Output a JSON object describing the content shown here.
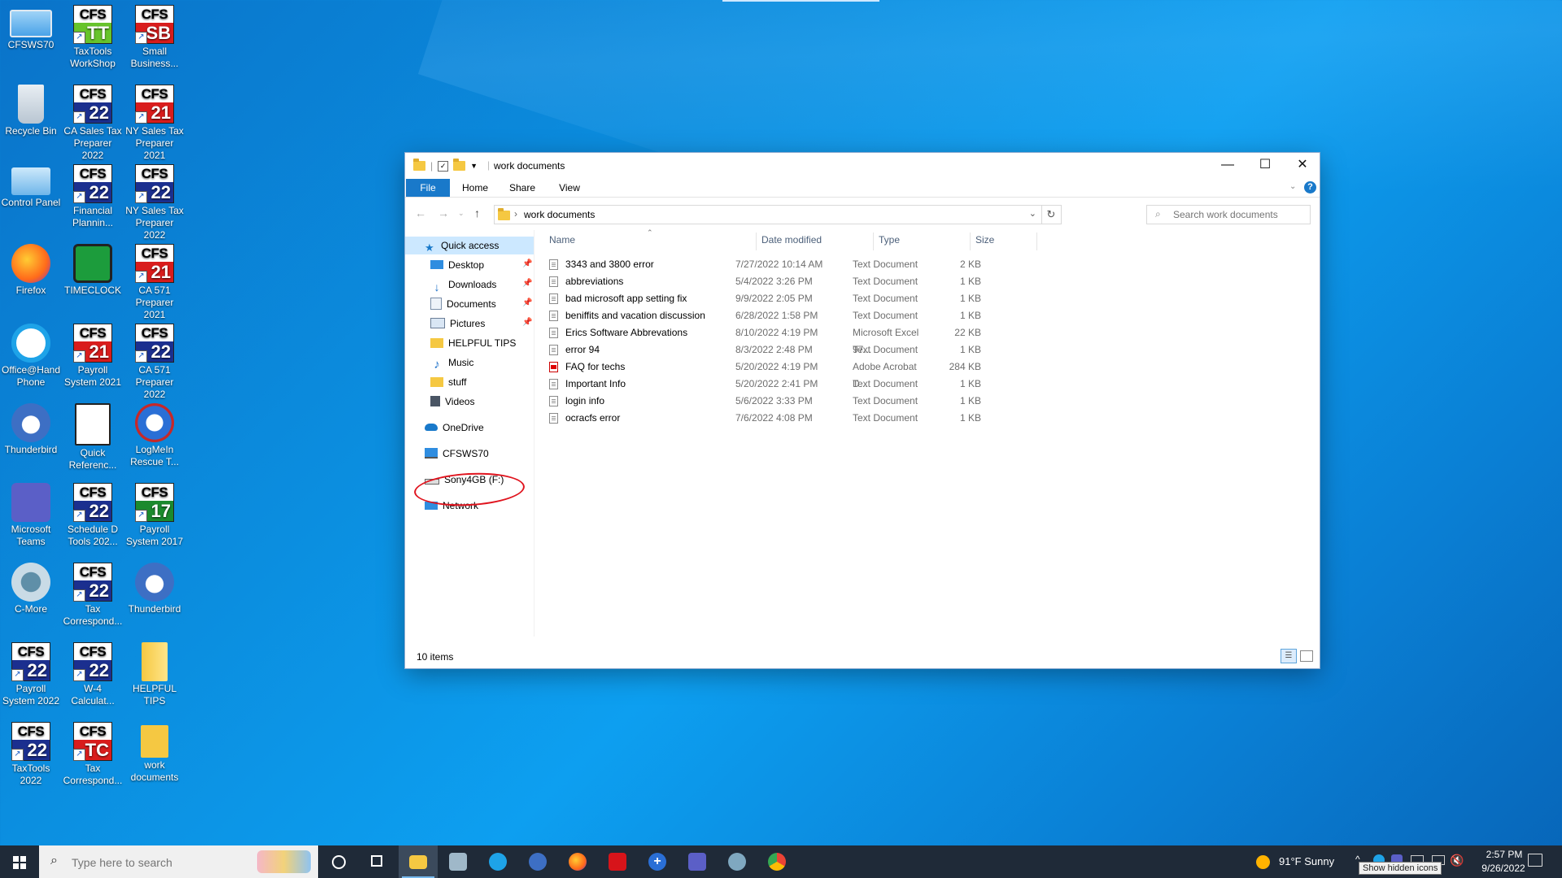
{
  "desktop": {
    "icons": [
      {
        "label": "CFSWS70"
      },
      {
        "label": "TaxTools WorkShop",
        "badge_top": "CFS",
        "badge_bottom": "TT"
      },
      {
        "label": "Small Business...",
        "badge_top": "CFS",
        "badge_bottom": "SB"
      },
      {
        "label": "Recycle Bin"
      },
      {
        "label": "CA Sales Tax Preparer 2022",
        "badge_top": "CFS",
        "badge_bottom": "22"
      },
      {
        "label": "NY Sales Tax Preparer 2021",
        "badge_top": "CFS",
        "badge_bottom": "21"
      },
      {
        "label": "Control Panel"
      },
      {
        "label": "Financial Plannin...",
        "badge_top": "CFS",
        "badge_bottom": "22"
      },
      {
        "label": "NY Sales Tax Preparer 2022",
        "badge_top": "CFS",
        "badge_bottom": "22"
      },
      {
        "label": "Firefox"
      },
      {
        "label": "TIMECLOCK"
      },
      {
        "label": "CA 571 Preparer 2021",
        "badge_top": "CFS",
        "badge_bottom": "21"
      },
      {
        "label": "Office@Hand Phone"
      },
      {
        "label": "Payroll System 2021",
        "badge_top": "CFS",
        "badge_bottom": "21"
      },
      {
        "label": "CA 571 Preparer 2022",
        "badge_top": "CFS",
        "badge_bottom": "22"
      },
      {
        "label": "Thunderbird"
      },
      {
        "label": "Quick Referenc..."
      },
      {
        "label": "LogMeIn Rescue T..."
      },
      {
        "label": "Microsoft Teams"
      },
      {
        "label": "Schedule D Tools 202...",
        "badge_top": "CFS",
        "badge_bottom": "22"
      },
      {
        "label": "Payroll System 2017",
        "badge_top": "CFS",
        "badge_bottom": "17"
      },
      {
        "label": "C-More"
      },
      {
        "label": "Tax Correspond...",
        "badge_top": "CFS",
        "badge_bottom": "22"
      },
      {
        "label": "Thunderbird"
      },
      {
        "label": "Payroll System 2022",
        "badge_top": "CFS",
        "badge_bottom": "22"
      },
      {
        "label": "W-4 Calculat...",
        "badge_top": "CFS",
        "badge_bottom": "22"
      },
      {
        "label": "HELPFUL TIPS"
      },
      {
        "label": "TaxTools 2022",
        "badge_top": "CFS",
        "badge_bottom": "22"
      },
      {
        "label": "Tax Correspond...",
        "badge_top": "CFS",
        "badge_bottom": "TC"
      },
      {
        "label": "work documents"
      }
    ]
  },
  "explorer": {
    "title": "work documents",
    "ribbon_tabs": [
      "File",
      "Home",
      "Share",
      "View"
    ],
    "address": "work documents",
    "search_placeholder": "Search work documents",
    "nav": {
      "quick_access": "Quick access",
      "items": [
        "Desktop",
        "Downloads",
        "Documents",
        "Pictures",
        "HELPFUL TIPS",
        "Music",
        "stuff",
        "Videos"
      ],
      "onedrive": "OneDrive",
      "pc": "CFSWS70",
      "drive": "Sony4GB (F:)",
      "network": "Network"
    },
    "columns": {
      "name": "Name",
      "date": "Date modified",
      "type": "Type",
      "size": "Size"
    },
    "files": [
      {
        "name": "3343 and 3800 error",
        "date": "7/27/2022 10:14 AM",
        "type": "Text Document",
        "size": "2 KB"
      },
      {
        "name": "abbreviations",
        "date": "5/4/2022 3:26 PM",
        "type": "Text Document",
        "size": "1 KB"
      },
      {
        "name": "bad microsoft app setting fix",
        "date": "9/9/2022 2:05 PM",
        "type": "Text Document",
        "size": "1 KB"
      },
      {
        "name": "beniffits and vacation discussion",
        "date": "6/28/2022 1:58 PM",
        "type": "Text Document",
        "size": "1 KB"
      },
      {
        "name": "Erics Software Abbrevations",
        "date": "8/10/2022 4:19 PM",
        "type": "Microsoft Excel 97...",
        "size": "22 KB"
      },
      {
        "name": "error 94",
        "date": "8/3/2022 2:48 PM",
        "type": "Text Document",
        "size": "1 KB"
      },
      {
        "name": "FAQ for techs",
        "date": "5/20/2022 4:19 PM",
        "type": "Adobe Acrobat D...",
        "size": "284 KB"
      },
      {
        "name": "Important Info",
        "date": "5/20/2022 2:41 PM",
        "type": "Text Document",
        "size": "1 KB"
      },
      {
        "name": "login info",
        "date": "5/6/2022 3:33 PM",
        "type": "Text Document",
        "size": "1 KB"
      },
      {
        "name": "ocracfs  error",
        "date": "7/6/2022 4:08 PM",
        "type": "Text Document",
        "size": "1 KB"
      }
    ],
    "status": "10 items"
  },
  "taskbar": {
    "search_placeholder": "Type here to search",
    "weather": "91°F  Sunny",
    "time": "2:57 PM",
    "date": "9/26/2022",
    "tooltip": "Show hidden icons"
  },
  "colors": {
    "accent": "#1979ca",
    "selection": "#cce8ff",
    "annotation": "#e0141e",
    "taskbar": "#1f2a38"
  }
}
